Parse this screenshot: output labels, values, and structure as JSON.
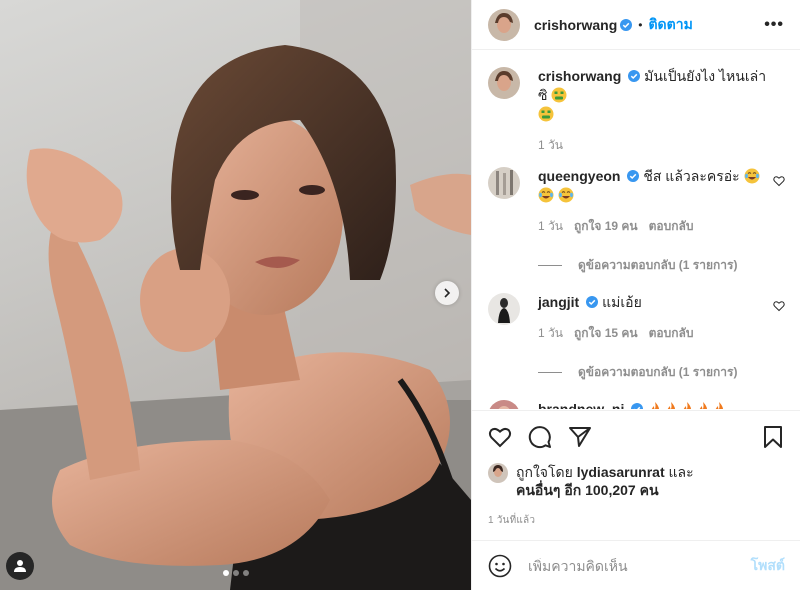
{
  "header": {
    "username": "crishorwang",
    "separator": "•",
    "follow_label": "ติดตาม",
    "more_label": "•••"
  },
  "comments": [
    {
      "username": "crishorwang",
      "text": "มันเป็นยังไง ไหนเล่าซิ",
      "emojis": [
        "money-mouth-face",
        "money-mouth-face"
      ],
      "time": "1 วัน"
    },
    {
      "username": "queengyeon",
      "text": "ชีส แล้วละครอ่ะ",
      "emojis": [
        "tears-of-joy",
        "tears-of-joy",
        "tears-of-joy"
      ],
      "time": "1 วัน",
      "likes": "ถูกใจ 19 คน",
      "reply_label": "ตอบกลับ",
      "view_replies": "ดูข้อความตอบกลับ (1 รายการ)"
    },
    {
      "username": "jangjit",
      "text": "แม่เอ้ย",
      "time": "1 วัน",
      "likes": "ถูกใจ 15 คน",
      "reply_label": "ตอบกลับ",
      "view_replies": "ดูข้อความตอบกลับ (1 รายการ)"
    },
    {
      "username": "brandnew_nj",
      "emojis": [
        "fire",
        "fire",
        "fire",
        "fire",
        "fire"
      ]
    }
  ],
  "likes": {
    "prefix": "ถูกใจโดย",
    "liker": "lydiasarunrat",
    "and": "และ",
    "others": "คนอื่นๆ อีก 100,207 คน"
  },
  "timestamp": "1 วันที่แล้ว",
  "comment_input": {
    "placeholder": "เพิ่มความคิดเห็น",
    "post_label": "โพสต์"
  },
  "carousel": {
    "total": 3,
    "current": 1
  },
  "colors": {
    "accent": "#0095f6",
    "post_disabled": "#b2dffc",
    "muted": "#8e8e8e",
    "text": "#262626"
  }
}
